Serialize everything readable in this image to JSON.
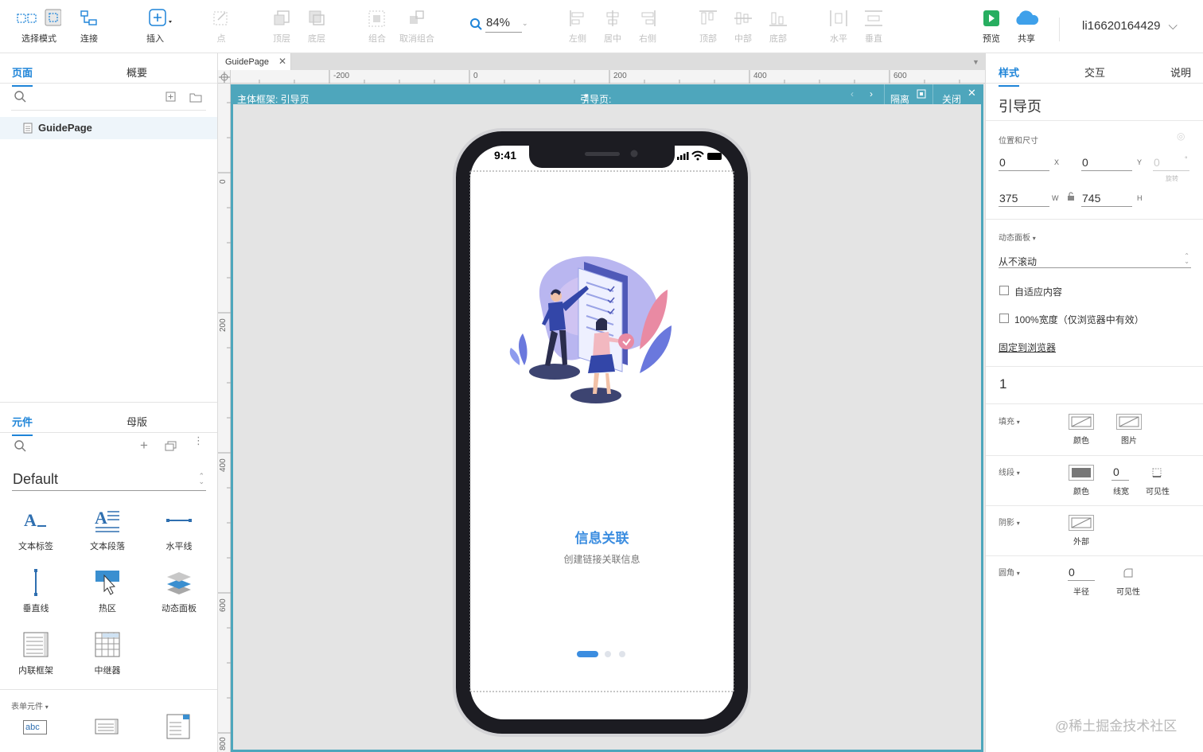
{
  "toolbar": {
    "select_mode": "选择模式",
    "connect": "连接",
    "insert": "插入",
    "point": "点",
    "top_layer": "顶层",
    "bottom_layer": "底层",
    "group": "组合",
    "ungroup": "取消组合",
    "zoom": "84%",
    "align_left": "左侧",
    "align_center": "居中",
    "align_right": "右侧",
    "align_top": "顶部",
    "align_middle": "中部",
    "align_bottom": "底部",
    "distribute_h": "水平",
    "distribute_v": "垂直",
    "preview": "预览",
    "share": "共享",
    "user": "li16620164429"
  },
  "left_panel": {
    "tabs": [
      "页面",
      "概要"
    ],
    "pages": [
      "GuidePage"
    ],
    "library_tabs": [
      "元件",
      "母版"
    ],
    "library_name": "Default",
    "widgets": [
      "文本标签",
      "文本段落",
      "水平线",
      "垂直线",
      "热区",
      "动态面板",
      "内联框架",
      "中继器"
    ],
    "form_section": "表单元件",
    "form_widget_text": "abc"
  },
  "canvas": {
    "tab_label": "GuidePage",
    "ruler_h": [
      "-200",
      "0",
      "200",
      "400",
      "600"
    ],
    "ruler_v": [
      "0",
      "200",
      "400",
      "600",
      "800"
    ],
    "frame_title": "主体框架: 引导页",
    "frame_more": "»",
    "frame_state": "引导页:",
    "frame_state_num": "1",
    "isolate": "隔离",
    "close": "关闭",
    "phone_time": "9:41",
    "headline": "信息关联",
    "subline": "创建链接关联信息"
  },
  "right_panel": {
    "tabs": [
      "样式",
      "交互",
      "说明"
    ],
    "name": "引导页",
    "position_size": "位置和尺寸",
    "x": "0",
    "x_label": "X",
    "y": "0",
    "y_label": "Y",
    "rotation": "0",
    "rotation_unit": "°",
    "rotation_label": "旋转",
    "w": "375",
    "w_label": "W",
    "h": "745",
    "h_label": "H",
    "dynamic_panel": "动态面板",
    "scroll_option": "从不滚动",
    "fit_content": "自适应内容",
    "full_width": "100%宽度（仅浏览器中有效）",
    "pin_browser": "固定到浏览器",
    "state_value": "1",
    "fill": "填充",
    "fill_color": "颜色",
    "fill_image": "图片",
    "line": "线段",
    "line_color": "颜色",
    "line_width_val": "0",
    "line_width": "线宽",
    "line_visibility": "可见性",
    "shadow": "阴影",
    "shadow_outer": "外部",
    "corner": "圆角",
    "corner_radius_val": "0",
    "corner_radius": "半径",
    "corner_visibility": "可见性"
  },
  "watermark": "@稀土掘金技术社区",
  "colors": {
    "accent": "#1e84d8",
    "frame": "#4ea6bc",
    "headline": "#3b8de0"
  }
}
